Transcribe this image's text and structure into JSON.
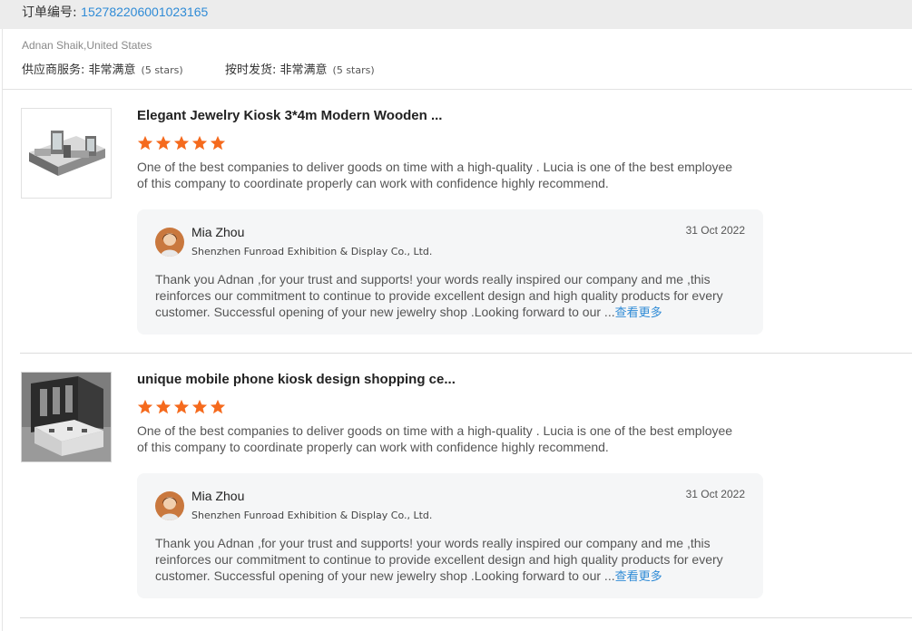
{
  "order": {
    "label": "订单编号: ",
    "number": "152782206001023165"
  },
  "buyer": {
    "name_location": "Adnan Shaik,United States"
  },
  "ratings": {
    "supplier_label": "供应商服务: ",
    "supplier_value": "非常满意",
    "supplier_stars": "(5 stars)",
    "ontime_label": "按时发货: ",
    "ontime_value": "非常满意",
    "ontime_stars": "(5 stars)"
  },
  "colors": {
    "star": "#f56a1d",
    "link": "#2f8bd6",
    "reply_bg": "#f5f6f7"
  },
  "reviews": [
    {
      "title": "Elegant Jewelry Kiosk 3*4m Modern Wooden ...",
      "stars": 5,
      "comment_line1": "One of the best companies to deliver goods on time with a high-quality . Lucia is one of the best employee",
      "comment_line2": "of this company to coordinate properly can work with confidence highly recommend.",
      "reply": {
        "name": "Mia Zhou",
        "company": "Shenzhen Funroad Exhibition & Display Co., Ltd.",
        "date": "31 Oct 2022",
        "line1": "Thank you Adnan ,for your trust and supports!  your words really inspired our company and me ,this",
        "line2": "reinforces our commitment to continue to provide excellent design and high quality products  for every",
        "line3": "customer. Successful opening of your new jewelry shop .Looking forward to our ...",
        "more": "查看更多"
      }
    },
    {
      "title": "unique mobile phone kiosk design shopping ce...",
      "stars": 5,
      "comment_line1": "One of the best companies to deliver goods on time with a high-quality . Lucia is one of the best employee",
      "comment_line2": "of this company to coordinate properly can work with confidence highly recommend.",
      "reply": {
        "name": "Mia Zhou",
        "company": "Shenzhen Funroad Exhibition & Display Co., Ltd.",
        "date": "31 Oct 2022",
        "line1": "Thank you Adnan ,for your trust and supports!  your words really inspired our company and me ,this",
        "line2": "reinforces our commitment to continue to provide excellent design and high quality products  for every",
        "line3": "customer. Successful opening of your new jewelry shop .Looking forward to our ...",
        "more": "查看更多"
      }
    }
  ]
}
